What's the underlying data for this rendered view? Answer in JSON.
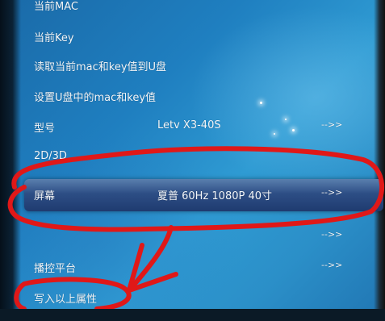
{
  "menu": {
    "items": [
      {
        "label": "当前MAC",
        "value": "",
        "arrow": ""
      },
      {
        "label": "当前Key",
        "value": "",
        "arrow": ""
      },
      {
        "label": "读取当前mac和key值到U盘",
        "value": "",
        "arrow": ""
      },
      {
        "label": "设置U盘中的mac和key值",
        "value": "",
        "arrow": ""
      },
      {
        "label": "型号",
        "value": "Letv X3-40S",
        "arrow": "-->>"
      },
      {
        "label": "2D/3D",
        "value": "",
        "arrow": ""
      },
      {
        "label": "屏幕",
        "value": "夏普 60Hz 1080P 40寸",
        "arrow": "-->>"
      },
      {
        "label": "",
        "value": "",
        "arrow": "-->>"
      },
      {
        "label": "播控平台",
        "value": "",
        "arrow": "-->>"
      },
      {
        "label": "写入以上属性",
        "value": "",
        "arrow": ""
      }
    ],
    "selected_index": 6
  },
  "colors": {
    "annotation": "#e01818",
    "selected_row": "#2d4e85",
    "background": "#1f7fc0"
  },
  "icons": [
    "hand-drawn-arrow"
  ]
}
